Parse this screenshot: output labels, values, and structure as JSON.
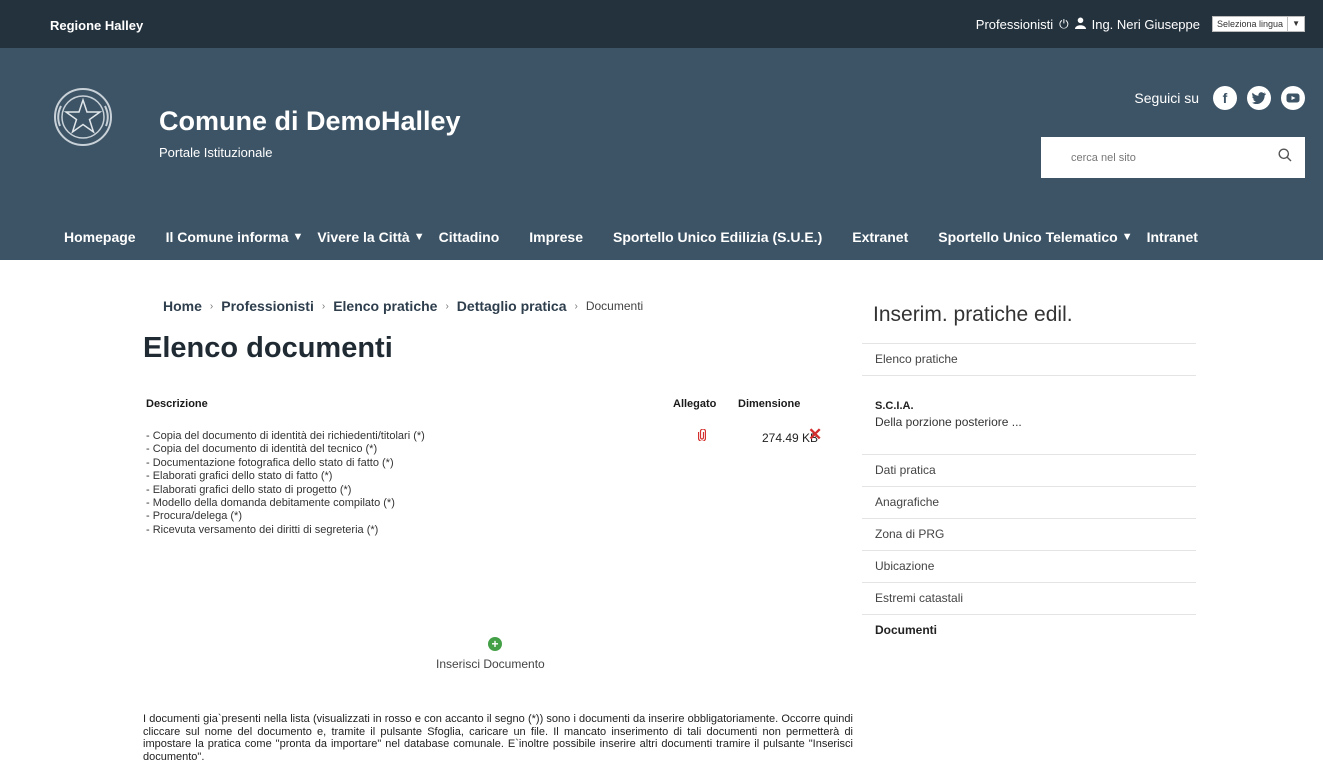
{
  "topbar": {
    "region": "Regione Halley",
    "professionals": "Professionisti",
    "user": "Ing. Neri Giuseppe",
    "language_select": "Seleziona lingua",
    "language_arrow": "▼"
  },
  "header": {
    "title": "Comune di DemoHalley",
    "subtitle": "Portale Istituzionale",
    "follow": "Seguici su",
    "search_placeholder": "cerca nel sito"
  },
  "nav": [
    {
      "label": "Homepage",
      "dropdown": false
    },
    {
      "label": "Il Comune informa",
      "dropdown": true
    },
    {
      "label": "Vivere la Città",
      "dropdown": true
    },
    {
      "label": "Cittadino",
      "dropdown": false
    },
    {
      "label": "Imprese",
      "dropdown": false
    },
    {
      "label": "Sportello Unico Edilizia (S.U.E.)",
      "dropdown": false
    },
    {
      "label": "Extranet",
      "dropdown": false
    },
    {
      "label": "Sportello Unico Telematico",
      "dropdown": true
    },
    {
      "label": "Intranet",
      "dropdown": false
    }
  ],
  "breadcrumb": {
    "items": [
      "Home",
      "Professionisti",
      "Elenco pratiche",
      "Dettaglio pratica"
    ],
    "current": "Documenti"
  },
  "page_title": "Elenco documenti",
  "table": {
    "headers": {
      "description": "Descrizione",
      "attachment": "Allegato",
      "size": "Dimensione"
    },
    "rows": [
      "- Copia del documento di identità dei richiedenti/titolari (*)",
      "- Copia del documento di identità del tecnico (*)",
      "- Documentazione fotografica dello stato di fatto (*)",
      "- Elaborati grafici dello stato di fatto (*)",
      "- Elaborati grafici dello stato di progetto (*)",
      "- Modello della domanda debitamente compilato (*)",
      "- Procura/delega (*)",
      "- Ricevuta versamento dei diritti di segreteria (*)"
    ],
    "first_row_size": "274.49 KB"
  },
  "insert_document": "Inserisci Documento",
  "note": "I documenti gia`presenti nella lista (visualizzati in rosso e con accanto il segno (*)) sono i documenti da inserire obbligatoriamente. Occorre quindi cliccare sul nome del documento e, tramite il pulsante Sfoglia, caricare un file. Il mancato inserimento di tali documenti non permetterà di impostare la pratica come \"pronta da importare\" nel database comunale. E`inoltre possibile inserire altri documenti tramire il pulsante \"Inserisci documento\".",
  "sidebar": {
    "title": "Inserim. pratiche edil.",
    "list_link": "Elenco pratiche",
    "practice_type": "S.C.I.A.",
    "practice_desc": "Della porzione posteriore ...",
    "items": [
      "Dati pratica",
      "Anagrafiche",
      "Zona di PRG",
      "Ubicazione",
      "Estremi catastali",
      "Documenti"
    ]
  },
  "colors": {
    "topbar_bg": "#24323e",
    "header_bg": "#3d5466",
    "required_red": "#d32f2f",
    "add_green": "#43a047"
  }
}
